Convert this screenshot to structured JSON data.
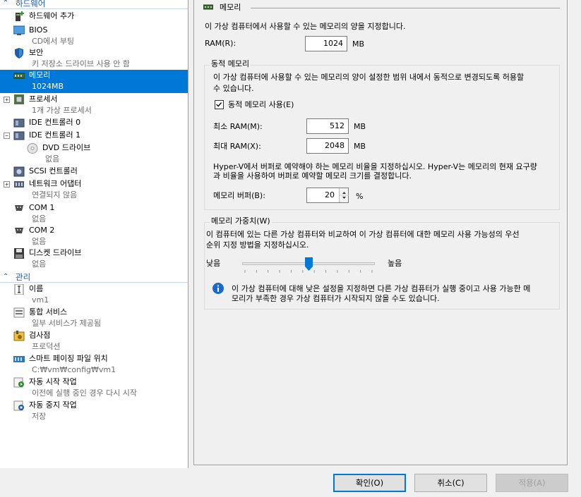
{
  "tree": {
    "hardware_section": "하드웨어",
    "management_section": "관리",
    "items": [
      {
        "key": "add-hardware",
        "label": "하드웨어 추가",
        "sub": ""
      },
      {
        "key": "bios",
        "label": "BIOS",
        "sub": "CD에서 부팅"
      },
      {
        "key": "security",
        "label": "보안",
        "sub": "키 저장소 드라이브 사용 안 함"
      },
      {
        "key": "memory",
        "label": "메모리",
        "sub": "1024MB"
      },
      {
        "key": "processor",
        "label": "프로세서",
        "sub": "1개 가상 프로세서"
      },
      {
        "key": "ide0",
        "label": "IDE 컨트롤러 0",
        "sub": ""
      },
      {
        "key": "ide1",
        "label": "IDE 컨트롤러 1",
        "sub": ""
      },
      {
        "key": "dvd",
        "label": "DVD 드라이브",
        "sub": "없음"
      },
      {
        "key": "scsi",
        "label": "SCSI 컨트롤러",
        "sub": ""
      },
      {
        "key": "network",
        "label": "네트워크 어댑터",
        "sub": "연결되지 않음"
      },
      {
        "key": "com1",
        "label": "COM 1",
        "sub": "없음"
      },
      {
        "key": "com2",
        "label": "COM 2",
        "sub": "없음"
      },
      {
        "key": "diskette",
        "label": "디스켓 드라이브",
        "sub": "없음"
      },
      {
        "key": "name",
        "label": "이름",
        "sub": "vm1"
      },
      {
        "key": "integration",
        "label": "통합 서비스",
        "sub": "일부 서비스가 제공됨"
      },
      {
        "key": "checkpoints",
        "label": "검사점",
        "sub": "프로덕션"
      },
      {
        "key": "paging",
        "label": "스마트 페이징 파일 위치",
        "sub": "C:₩vm₩config₩vm1"
      },
      {
        "key": "autostart",
        "label": "자동 시작 작업",
        "sub": "이전에 실행 중인 경우 다시 시작"
      },
      {
        "key": "autostop",
        "label": "자동 중지 작업",
        "sub": "저장"
      }
    ]
  },
  "memory": {
    "header": "메모리",
    "description": "이 가상 컴퓨터에서 사용할 수 있는 메모리의 양을 지정합니다.",
    "ram_label": "RAM(R):",
    "ram_value": "1024",
    "unit_mb": "MB",
    "dynamic": {
      "title": "동적 메모리",
      "desc_line1": "이 가상 컴퓨터에 사용할 수 있는 메모리의 양이 설정한 범위 내에서 동적으로 변경되도록 허용할",
      "desc_line2": "수 있습니다.",
      "checkbox_label": "동적 메모리 사용(E)",
      "checkbox_checked": true,
      "min_label": "최소 RAM(M):",
      "min_value": "512",
      "max_label": "최대 RAM(X):",
      "max_value": "2048",
      "buffer_desc_line1": "Hyper-V에서 버퍼로 예약해야 하는 메모리 비율을 지정하십시오. Hyper-V는 메모리의 현재 요구량",
      "buffer_desc_line2": "과 비율을 사용하여 버퍼로 예약할 메모리 크기를 결정합니다.",
      "buffer_label": "메모리 버퍼(B):",
      "buffer_value": "20",
      "percent": "%"
    },
    "weight": {
      "title": "메모리 가중치(W)",
      "desc_line1": "이 컴퓨터에 있는 다른 가상 컴퓨터와 비교하여 이 가상 컴퓨터에 대한 메모리 사용 가능성의 우선",
      "desc_line2": "순위 지정 방법을 지정하십시오.",
      "low_label": "낮음",
      "high_label": "높음",
      "slider_level": 0.5,
      "info_line1": "이 가상 컴퓨터에 대해 낮은 설정을 지정하면 다른 가상 컴퓨터가 실행 중이고 사용 가능한 메",
      "info_line2": "모리가 부족한 경우 가상 컴퓨터가 시작되지 않을 수도 있습니다."
    }
  },
  "buttons": {
    "ok": "확인(O)",
    "cancel": "취소(C)",
    "apply": "적용(A)"
  },
  "colors": {
    "accent": "#0078d7",
    "section_text": "#1a57a6"
  }
}
